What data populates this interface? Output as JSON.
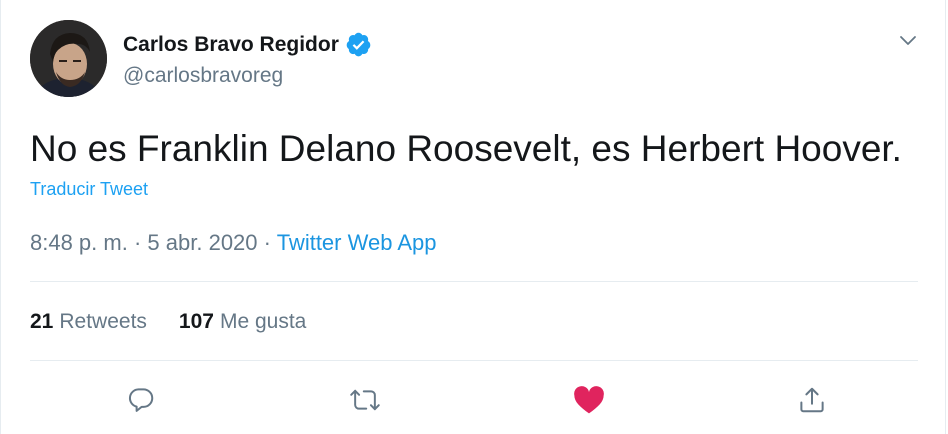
{
  "user": {
    "display_name": "Carlos Bravo Regidor",
    "handle": "@carlosbravoreg"
  },
  "tweet": {
    "text": "No es Franklin Delano Roosevelt, es Herbert Hoover.",
    "translate_label": "Traducir Tweet",
    "time": "8:48 p. m.",
    "date": "5 abr. 2020",
    "separator": "·",
    "source": "Twitter Web App"
  },
  "stats": {
    "retweets_count": "21",
    "retweets_label": "Retweets",
    "likes_count": "107",
    "likes_label": "Me gusta"
  },
  "colors": {
    "accent": "#1da1f2",
    "like": "#e0245e",
    "muted": "#657786",
    "divider": "#e6ecf0"
  },
  "icons": [
    "verified-badge-icon",
    "chevron-down-icon",
    "reply-icon",
    "retweet-icon",
    "heart-icon",
    "share-icon"
  ]
}
